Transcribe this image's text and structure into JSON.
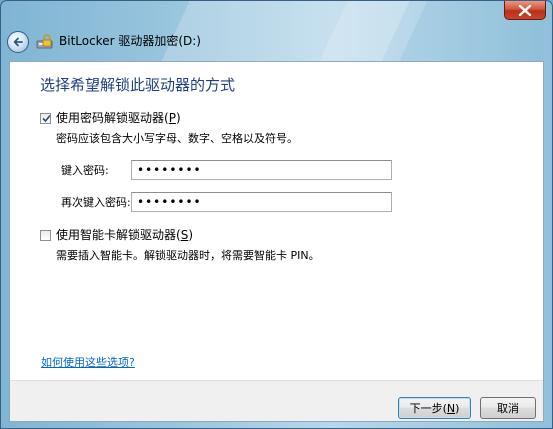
{
  "window": {
    "title": "BitLocker 驱动器加密(D:)"
  },
  "content": {
    "heading": "选择希望解锁此驱动器的方式",
    "password_option": {
      "label_prefix": "使用密码解锁驱动器(",
      "accel": "P",
      "label_suffix": ")",
      "checked": true,
      "description": "密码应该包含大小写字母、数字、空格以及符号。"
    },
    "password_field": {
      "label": "键入密码:",
      "value": "••••••••"
    },
    "confirm_field": {
      "label": "再次键入密码:",
      "value": "••••••••"
    },
    "smartcard_option": {
      "label_prefix": "使用智能卡解锁驱动器(",
      "accel": "S",
      "label_suffix": ")",
      "checked": false,
      "description": "需要插入智能卡。解锁驱动器时，将需要智能卡 PIN。"
    },
    "help_link": "如何使用这些选项?"
  },
  "footer": {
    "next_button": {
      "label_prefix": "下一步(",
      "accel": "N",
      "label_suffix": ")"
    },
    "cancel_button": "取消"
  },
  "colors": {
    "heading": "#1f3f82",
    "link": "#0066cc",
    "close_button": "#c8452a"
  }
}
